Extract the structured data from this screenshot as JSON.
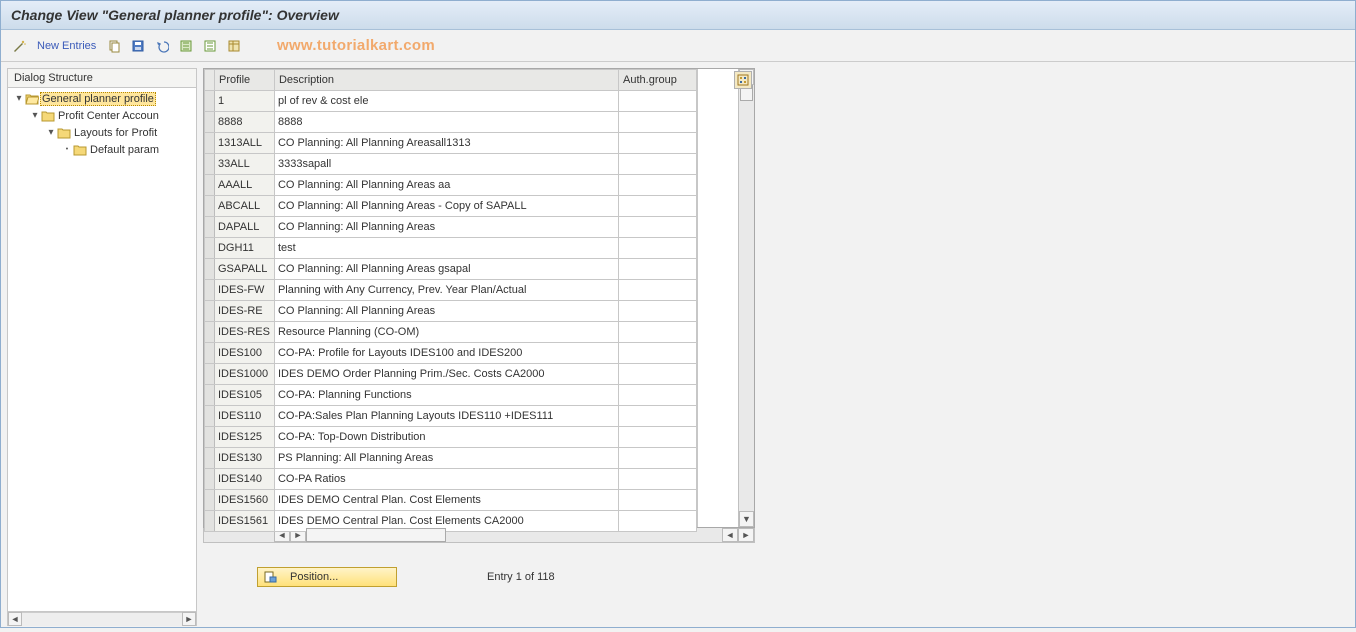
{
  "title": "Change View \"General planner profile\": Overview",
  "toolbar": {
    "new_entries_label": "New Entries"
  },
  "watermark": "www.tutorialkart.com",
  "tree": {
    "header": "Dialog Structure",
    "nodes": [
      {
        "label": "General planner profile",
        "indent": 0,
        "selected": true,
        "open": true,
        "folder": "open"
      },
      {
        "label": "Profit Center Accoun",
        "indent": 1,
        "selected": false,
        "open": true,
        "folder": "closed"
      },
      {
        "label": "Layouts for Profit",
        "indent": 2,
        "selected": false,
        "open": true,
        "folder": "closed"
      },
      {
        "label": "Default param",
        "indent": 3,
        "selected": false,
        "open": false,
        "folder": "closed"
      }
    ]
  },
  "table": {
    "columns": [
      "Profile",
      "Description",
      "Auth.group"
    ],
    "rows": [
      {
        "profile": "1",
        "description": "pl of rev & cost ele",
        "auth": ""
      },
      {
        "profile": "8888",
        "description": "8888",
        "auth": ""
      },
      {
        "profile": "1313ALL",
        "description": "CO Planning: All Planning Areasall1313",
        "auth": ""
      },
      {
        "profile": "33ALL",
        "description": "3333sapall",
        "auth": ""
      },
      {
        "profile": "AAALL",
        "description": "CO Planning: All Planning Areas aa",
        "auth": ""
      },
      {
        "profile": "ABCALL",
        "description": "CO Planning: All Planning Areas - Copy of SAPALL",
        "auth": ""
      },
      {
        "profile": "DAPALL",
        "description": "CO Planning: All Planning Areas",
        "auth": ""
      },
      {
        "profile": "DGH11",
        "description": "test",
        "auth": ""
      },
      {
        "profile": "GSAPALL",
        "description": "CO Planning: All Planning Areas gsapal",
        "auth": ""
      },
      {
        "profile": "IDES-FW",
        "description": "Planning with Any Currency, Prev. Year Plan/Actual",
        "auth": ""
      },
      {
        "profile": "IDES-RE",
        "description": "CO Planning: All Planning Areas",
        "auth": ""
      },
      {
        "profile": "IDES-RES",
        "description": "Resource Planning (CO-OM)",
        "auth": ""
      },
      {
        "profile": "IDES100",
        "description": "CO-PA: Profile for Layouts IDES100 and IDES200",
        "auth": ""
      },
      {
        "profile": "IDES1000",
        "description": "IDES DEMO Order Planning Prim./Sec. Costs   CA2000",
        "auth": ""
      },
      {
        "profile": "IDES105",
        "description": "CO-PA: Planning Functions",
        "auth": ""
      },
      {
        "profile": "IDES110",
        "description": "CO-PA:Sales Plan Planning Layouts IDES110 +IDES111",
        "auth": ""
      },
      {
        "profile": "IDES125",
        "description": "CO-PA: Top-Down Distribution",
        "auth": ""
      },
      {
        "profile": "IDES130",
        "description": "PS Planning: All Planning Areas",
        "auth": ""
      },
      {
        "profile": "IDES140",
        "description": "CO-PA Ratios",
        "auth": ""
      },
      {
        "profile": "IDES1560",
        "description": "IDES DEMO Central Plan. Cost Elements",
        "auth": ""
      },
      {
        "profile": "IDES1561",
        "description": "IDES DEMO Central Plan. Cost Elements       CA2000",
        "auth": ""
      }
    ]
  },
  "footer": {
    "position_label": "Position...",
    "entry_counter": "Entry 1 of 118"
  }
}
